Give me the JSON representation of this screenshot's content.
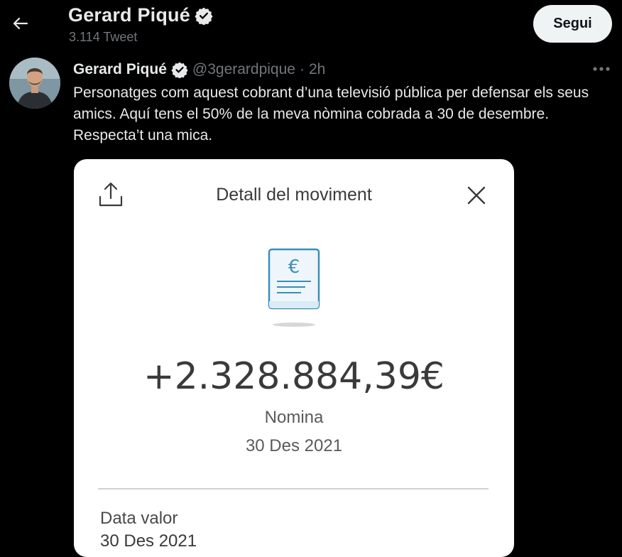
{
  "header": {
    "back_icon": "arrow-left-icon",
    "profile_name": "Gerard Piqué",
    "verified_icon": "verified-badge-icon",
    "tweet_count": "3.114 Tweet",
    "follow_label": "Segui"
  },
  "tweet": {
    "author_name": "Gerard Piqué",
    "handle": "@3gerardpique",
    "separator": "·",
    "time": "2h",
    "more_icon": "more-dots-icon",
    "text": "Personatges com aquest cobrant d’una televisió pública per defensar els seus amics. Aquí tens el 50% de la meva nòmina cobrada a 30 de desembre. Respecta’t una mica."
  },
  "media": {
    "share_icon": "share-icon",
    "title": "Detall del moviment",
    "close_icon": "close-icon",
    "document_icon": "euro-document-icon",
    "amount": "+2.328.884,39€",
    "concept": "Nomina",
    "date": "30 Des 2021",
    "value_date_label": "Data valor",
    "value_date": "30 Des 2021"
  },
  "colors": {
    "background": "#000000",
    "text_primary": "#e7e9ea",
    "text_secondary": "#71767b",
    "button_bg": "#eff3f4",
    "card_bg": "#ffffff",
    "icon_blue": "#3a8fb7"
  }
}
